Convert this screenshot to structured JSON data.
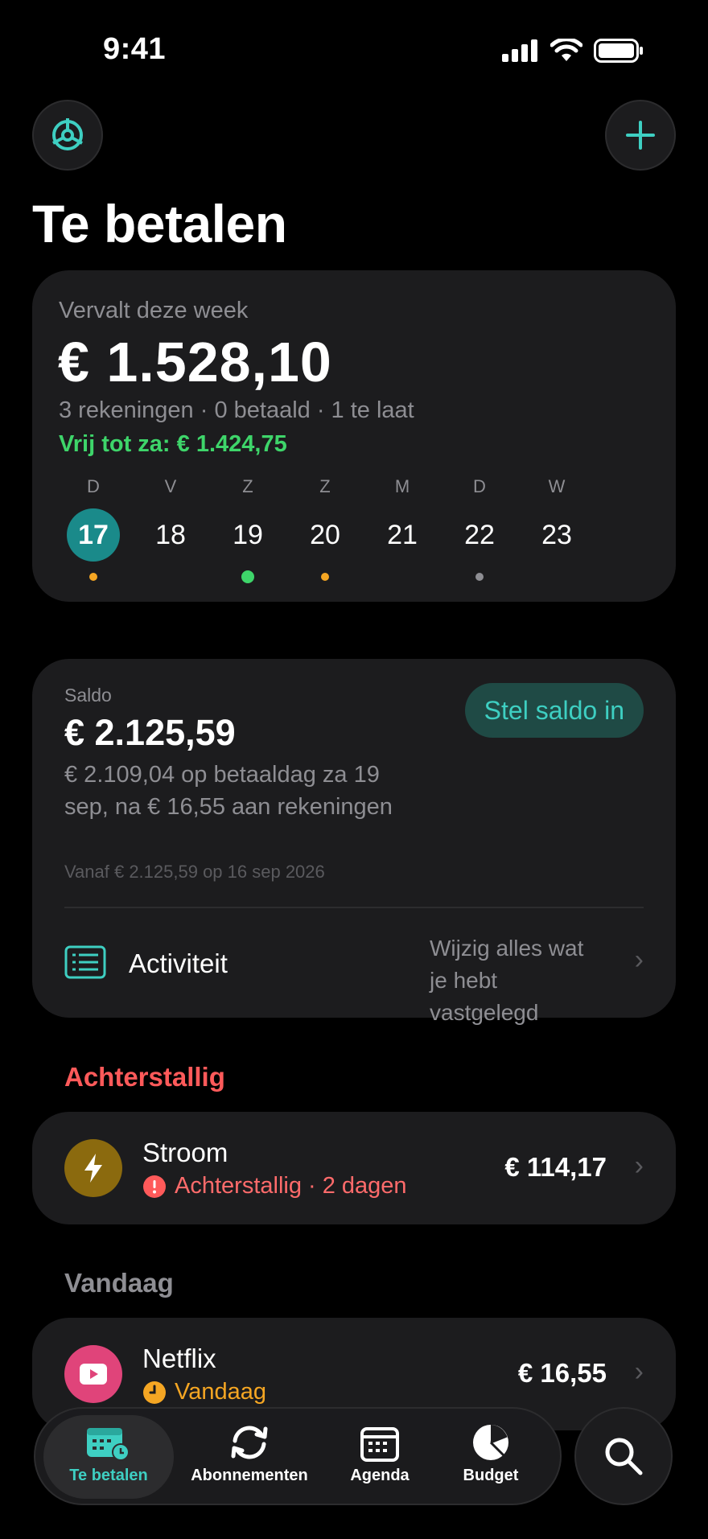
{
  "status_bar": {
    "time": "9:41"
  },
  "header": {
    "title": "Te betalen"
  },
  "week_card": {
    "label": "Vervalt deze week",
    "amount": "€ 1.528,10",
    "summary": "3 rekeningen · 0 betaald · 1 te laat",
    "free_until": "Vrij tot za: € 1.424,75",
    "days": [
      {
        "letter": "D",
        "number": "17",
        "today": true,
        "marker": "orange"
      },
      {
        "letter": "V",
        "number": "18",
        "today": false,
        "marker": "none"
      },
      {
        "letter": "Z",
        "number": "19",
        "today": false,
        "marker": "green"
      },
      {
        "letter": "Z",
        "number": "20",
        "today": false,
        "marker": "orange"
      },
      {
        "letter": "M",
        "number": "21",
        "today": false,
        "marker": "none"
      },
      {
        "letter": "D",
        "number": "22",
        "today": false,
        "marker": "grey"
      },
      {
        "letter": "W",
        "number": "23",
        "today": false,
        "marker": "none"
      }
    ]
  },
  "saldo_card": {
    "label": "Saldo",
    "amount": "€ 2.125,59",
    "description": "€ 2.109,04 op betaaldag za 19 sep, na € 16,55 aan rekeningen",
    "from": "Vanaf € 2.125,59 op 16 sep 2026",
    "set_button": "Stel saldo in",
    "activity_label": "Activiteit",
    "activity_hint": "Wijzig alles wat je hebt vastgelegd"
  },
  "sections": {
    "overdue": {
      "title": "Achterstallig",
      "bill": {
        "name": "Stroom",
        "status": "Achterstallig · 2 dagen",
        "amount": "€ 114,17",
        "icon": "lightning-icon"
      }
    },
    "today": {
      "title": "Vandaag",
      "bill": {
        "name": "Netflix",
        "status": "Vandaag",
        "amount": "€ 16,55",
        "icon": "play-icon"
      }
    }
  },
  "tabbar": {
    "tabs": [
      {
        "label": "Te betalen",
        "icon": "calendar-clock-icon",
        "active": true
      },
      {
        "label": "Abonnementen",
        "icon": "refresh-icon",
        "active": false
      },
      {
        "label": "Agenda",
        "icon": "calendar-icon",
        "active": false
      },
      {
        "label": "Budget",
        "icon": "pie-chart-icon",
        "active": false
      }
    ]
  },
  "colors": {
    "accent": "#3ecfc2",
    "today_circle": "#1a8a8a",
    "positive": "#3ed56a",
    "overdue": "#ff5a5a",
    "warning": "#f5a623",
    "card": "#1c1c1e"
  }
}
